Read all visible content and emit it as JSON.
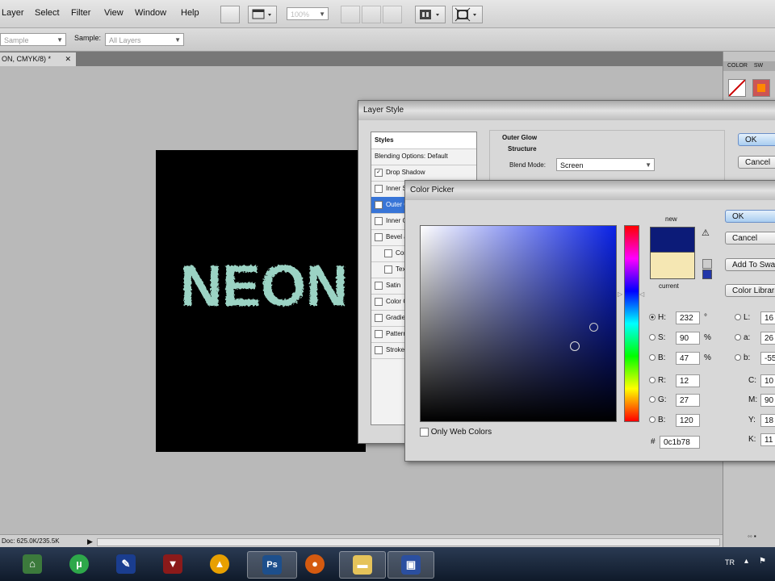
{
  "menubar": {
    "items": [
      "Layer",
      "Select",
      "Filter",
      "View",
      "Window",
      "Help"
    ],
    "zoom": "100%"
  },
  "options_bar": {
    "sample_size_value": "Sample",
    "sample_label": "Sample:",
    "sample_value": "All Layers"
  },
  "document_tab": {
    "label": "ON, CMYK/8) *",
    "close": "✕"
  },
  "canvas": {
    "text": "NEON"
  },
  "status_bar": {
    "doc_size": "Doc: 625.0K/235.5K"
  },
  "layer_style": {
    "title": "Layer Style",
    "styles_items": [
      {
        "label": "Styles",
        "checkbox": false,
        "checked": false,
        "selected": false,
        "indent": false
      },
      {
        "label": "Blending Options: Default",
        "checkbox": false,
        "checked": false,
        "selected": false,
        "indent": false
      },
      {
        "label": "Drop Shadow",
        "checkbox": true,
        "checked": true,
        "selected": false,
        "indent": false
      },
      {
        "label": "Inner Shadow",
        "checkbox": true,
        "checked": false,
        "selected": false,
        "indent": false
      },
      {
        "label": "Outer Glow",
        "checkbox": true,
        "checked": true,
        "selected": true,
        "indent": false
      },
      {
        "label": "Inner Glow",
        "checkbox": true,
        "checked": false,
        "selected": false,
        "indent": false
      },
      {
        "label": "Bevel and Emboss",
        "checkbox": true,
        "checked": false,
        "selected": false,
        "indent": false
      },
      {
        "label": "Contour",
        "checkbox": true,
        "checked": false,
        "selected": false,
        "indent": true
      },
      {
        "label": "Texture",
        "checkbox": true,
        "checked": false,
        "selected": false,
        "indent": true
      },
      {
        "label": "Satin",
        "checkbox": true,
        "checked": false,
        "selected": false,
        "indent": false
      },
      {
        "label": "Color Overlay",
        "checkbox": true,
        "checked": false,
        "selected": false,
        "indent": false
      },
      {
        "label": "Gradient Overlay",
        "checkbox": true,
        "checked": false,
        "selected": false,
        "indent": false
      },
      {
        "label": "Pattern Overlay",
        "checkbox": true,
        "checked": false,
        "selected": false,
        "indent": false
      },
      {
        "label": "Stroke",
        "checkbox": true,
        "checked": false,
        "selected": false,
        "indent": false
      }
    ],
    "section_title": "Outer Glow",
    "structure_label": "Structure",
    "blend_mode_label": "Blend Mode:",
    "blend_mode_value": "Screen",
    "ok_label": "OK",
    "cancel_label": "Cancel"
  },
  "color_picker": {
    "title": "Color Picker",
    "new_label": "new",
    "current_label": "current",
    "new_color": "#0c1b78",
    "current_color": "#f5e7b3",
    "ok_label": "OK",
    "cancel_label": "Cancel",
    "add_swatches_label": "Add To Swatches",
    "color_libraries_label": "Color Libraries",
    "only_web_colors_label": "Only Web Colors",
    "fields": {
      "H": {
        "label": "H:",
        "value": "232",
        "unit": "°",
        "selected": true
      },
      "S": {
        "label": "S:",
        "value": "90",
        "unit": "%",
        "selected": false
      },
      "B": {
        "label": "B:",
        "value": "47",
        "unit": "%",
        "selected": false
      },
      "R": {
        "label": "R:",
        "value": "12",
        "unit": "",
        "selected": false
      },
      "G": {
        "label": "G:",
        "value": "27",
        "unit": "",
        "selected": false
      },
      "Bb": {
        "label": "B:",
        "value": "120",
        "unit": "",
        "selected": false
      },
      "L": {
        "label": "L:",
        "value": "16"
      },
      "a": {
        "label": "a:",
        "value": "26"
      },
      "b": {
        "label": "b:",
        "value": "-55"
      },
      "C": {
        "label": "C:",
        "value": "10"
      },
      "M": {
        "label": "M:",
        "value": "90"
      },
      "Y": {
        "label": "Y:",
        "value": "18"
      },
      "K": {
        "label": "K:",
        "value": "11"
      }
    },
    "hex_label": "#",
    "hex_value": "0c1b78"
  },
  "right_panel": {
    "tab1": "COLOR",
    "tab2": "SW"
  },
  "taskbar": {
    "lang": "TR",
    "apps": [
      "explorer",
      "utorrent",
      "pen-tablet",
      "antivirus",
      "app-orange",
      "photoshop",
      "firefox",
      "folder",
      "bridge"
    ],
    "active": [
      "photoshop",
      "folder",
      "bridge"
    ],
    "photoshop_label": "Ps"
  }
}
